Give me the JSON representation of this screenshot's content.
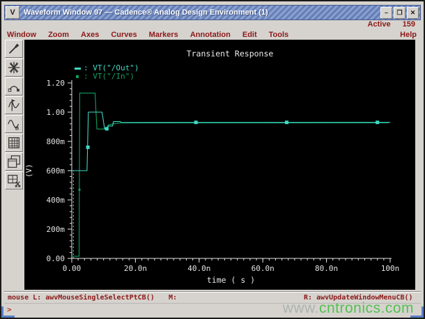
{
  "titlebar": {
    "title": "Waveform Window 97 — Cadence® Analog Design Environment (1)",
    "minimize": "–",
    "maximize": "❐",
    "close": "✕",
    "menu_glyph": "V"
  },
  "active": {
    "label": "Active",
    "value": "159"
  },
  "menubar": {
    "items": [
      "Window",
      "Zoom",
      "Axes",
      "Curves",
      "Markers",
      "Annotation",
      "Edit",
      "Tools"
    ],
    "help": "Help"
  },
  "toolbar": {
    "buttons": [
      {
        "icon": "brush-icon"
      },
      {
        "icon": "starburst-icon"
      },
      {
        "icon": "arc-tool-icon"
      },
      {
        "icon": "waveform-marker-icon"
      },
      {
        "icon": "waveform-b-icon"
      },
      {
        "icon": "calculator-icon"
      },
      {
        "icon": "copy-window-icon"
      },
      {
        "icon": "window-cut-icon"
      }
    ]
  },
  "chart_data": {
    "type": "line",
    "title": "Transient Response",
    "xlabel": "time ( s )",
    "ylabel": "(V)",
    "x_unit": "ns",
    "xlim": [
      0,
      100
    ],
    "ylim": [
      0,
      1.2
    ],
    "grid": false,
    "legend_position": "top-left",
    "x_ticks": [
      {
        "v": 0,
        "label": "0.00"
      },
      {
        "v": 20,
        "label": "20.0n"
      },
      {
        "v": 40,
        "label": "40.0n"
      },
      {
        "v": 60,
        "label": "60.0n"
      },
      {
        "v": 80,
        "label": "80.0n"
      },
      {
        "v": 100,
        "label": "100n"
      }
    ],
    "x_minor_step": 2,
    "y_ticks": [
      {
        "v": 0,
        "label": "0.00"
      },
      {
        "v": 0.2,
        "label": "200m"
      },
      {
        "v": 0.4,
        "label": "400m"
      },
      {
        "v": 0.6,
        "label": "600m"
      },
      {
        "v": 0.8,
        "label": "800m"
      },
      {
        "v": 1.0,
        "label": "1.00"
      },
      {
        "v": 1.2,
        "label": "1.20"
      }
    ],
    "y_minor_step": 0.04,
    "series": [
      {
        "name": "VT(\"/Out\")",
        "color": "#3ed9c4",
        "marker": "square",
        "points": [
          [
            0,
            0.6
          ],
          [
            4.8,
            0.6
          ],
          [
            5.2,
            1.0
          ],
          [
            9.5,
            1.0
          ],
          [
            10.3,
            0.888
          ],
          [
            11.0,
            0.883
          ],
          [
            11.5,
            0.905
          ],
          [
            12.8,
            0.905
          ],
          [
            13.1,
            0.935
          ],
          [
            15.2,
            0.935
          ],
          [
            15.6,
            0.929
          ],
          [
            100,
            0.93
          ]
        ],
        "marker_points": [
          [
            5.05,
            0.76
          ],
          [
            11.0,
            0.886
          ],
          [
            39,
            0.93
          ],
          [
            67.5,
            0.93
          ],
          [
            96,
            0.93
          ]
        ]
      },
      {
        "name": "VT(\"/In\")",
        "color": "#0fa05f",
        "marker": "dot",
        "points": [
          [
            0,
            0.015
          ],
          [
            2.3,
            0.015
          ],
          [
            2.5,
            1.13
          ],
          [
            7.3,
            1.13
          ],
          [
            7.9,
            0.885
          ],
          [
            10.9,
            0.885
          ],
          [
            11.4,
            0.912
          ],
          [
            13.0,
            0.92
          ],
          [
            15.5,
            0.926
          ],
          [
            99.5,
            0.927
          ]
        ],
        "marker_points": [
          [
            2.4,
            0.47
          ],
          [
            10.6,
            0.887
          ]
        ]
      }
    ],
    "initial_condition_dash": {
      "t": 0.5,
      "from": 0,
      "to": 0.6,
      "color": "#9fd8cc"
    }
  },
  "statusbar": {
    "left_label": "mouse L:",
    "left_value": "awvMouseSingleSelectPtCB()",
    "middle_label": "M:",
    "right_label": "R:",
    "right_value": "awvUpdateWindowMenuCB()",
    "prompt": ">"
  },
  "watermark": {
    "gray": "www.",
    "green": "cntronics.com"
  },
  "colors": {
    "menu_text": "#8b1a1a",
    "titlebar_blue": "#657fb8",
    "plot_bg": "#000000",
    "axis": "#e4e4e4",
    "out_trace": "#3ed9c4",
    "in_trace": "#0fa05f"
  }
}
